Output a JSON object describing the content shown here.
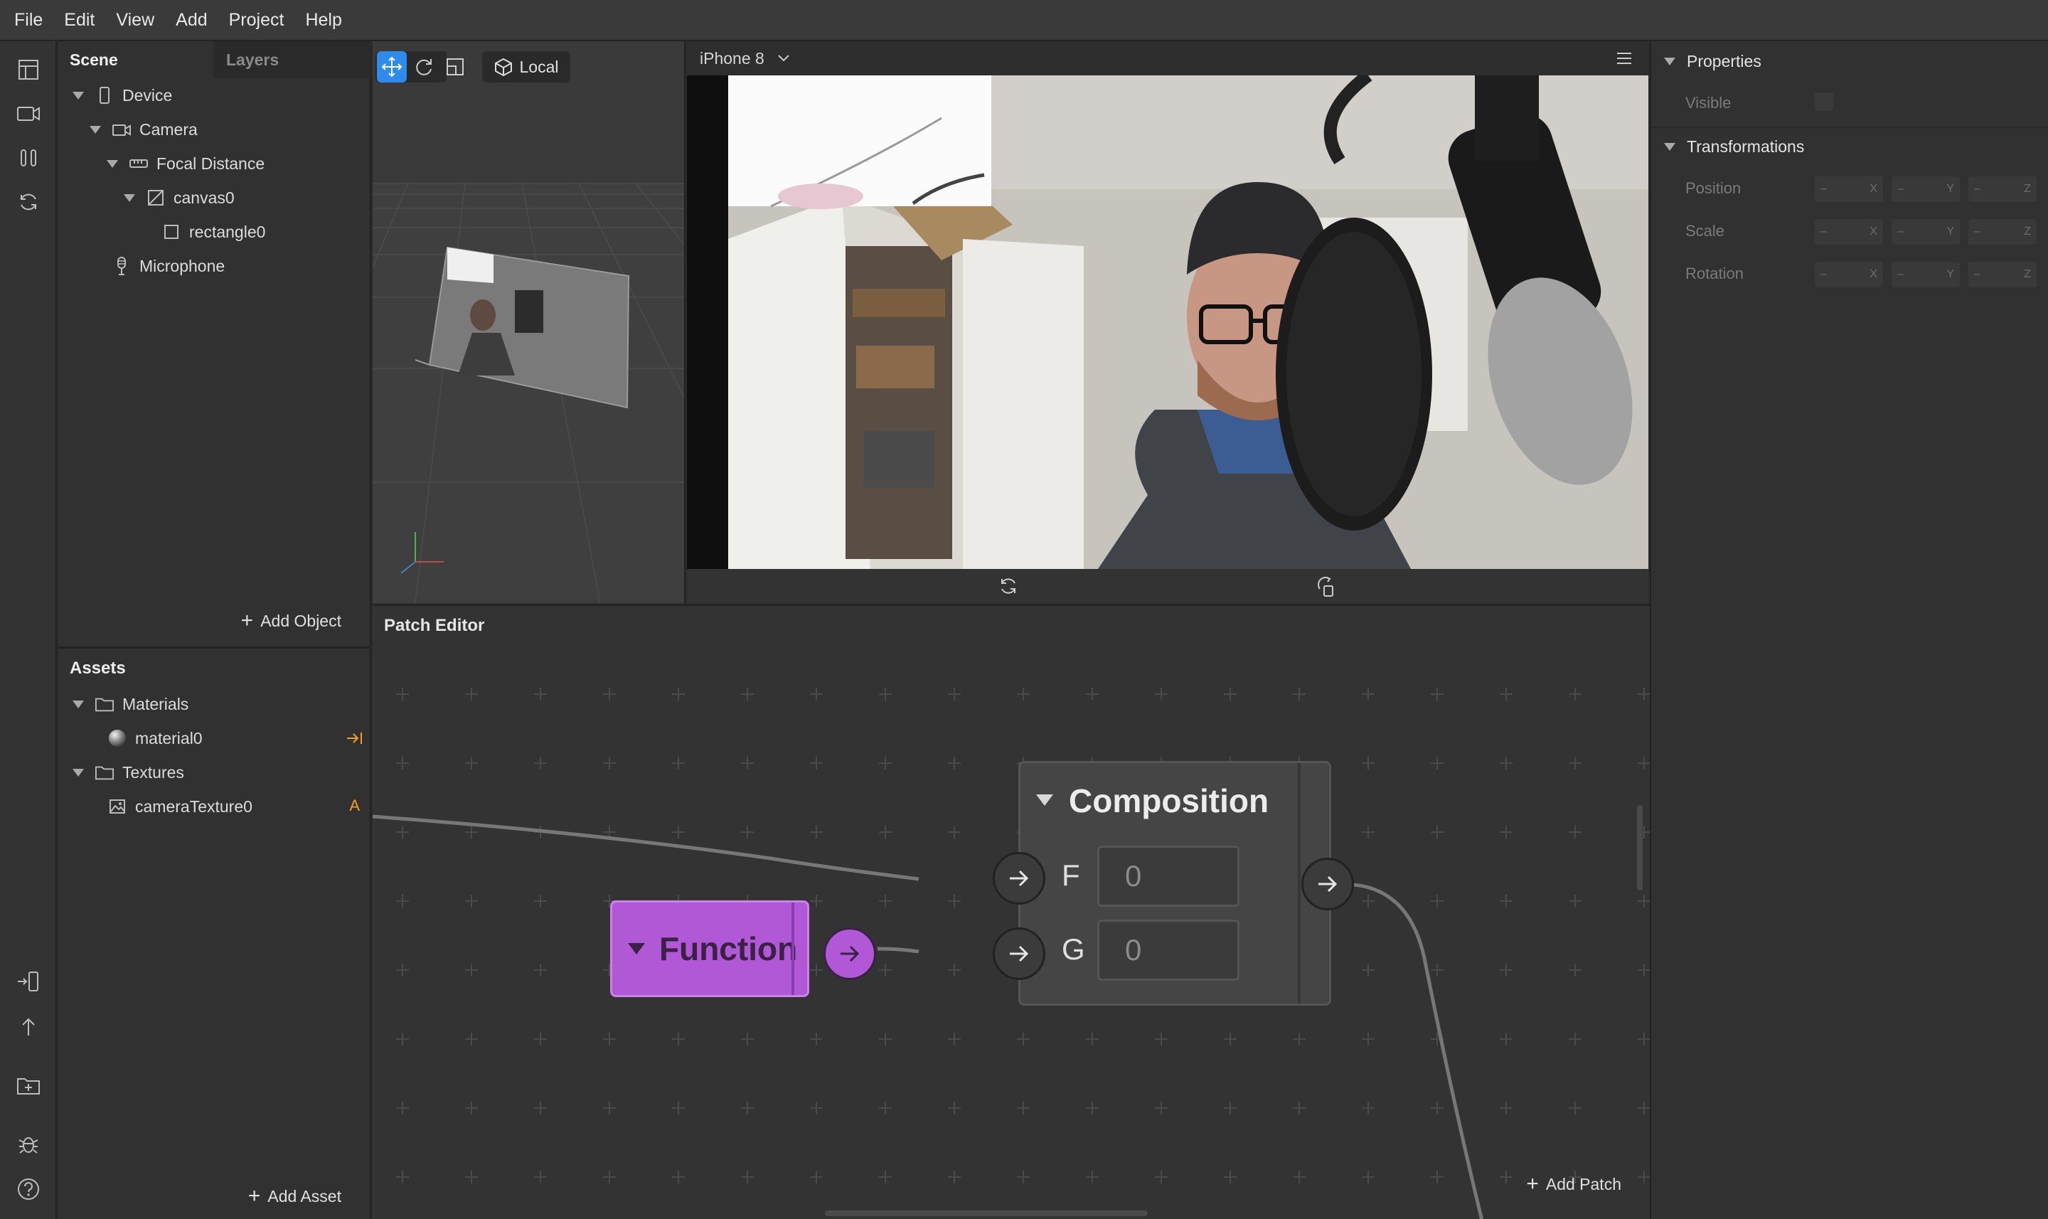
{
  "menu": [
    "File",
    "Edit",
    "View",
    "Add",
    "Project",
    "Help"
  ],
  "scene": {
    "tabs": [
      "Scene",
      "Layers"
    ],
    "tree": [
      {
        "label": "Device",
        "icon": "device-icon"
      },
      {
        "label": "Camera",
        "icon": "camera-icon"
      },
      {
        "label": "Focal Distance",
        "icon": "focal-distance-icon"
      },
      {
        "label": "canvas0",
        "icon": "canvas-icon"
      },
      {
        "label": "rectangle0",
        "icon": "rectangle-icon"
      },
      {
        "label": "Microphone",
        "icon": "microphone-icon"
      }
    ],
    "add_object": "Add Object"
  },
  "assets": {
    "title": "Assets",
    "materials_label": "Materials",
    "material0": "material0",
    "textures_label": "Textures",
    "texture0": "cameraTexture0",
    "texture_badge": "A"
  },
  "viewport": {
    "mode_label": "Local"
  },
  "simulator": {
    "device_label": "iPhone 8"
  },
  "properties": {
    "section_properties": "Properties",
    "visible_label": "Visible",
    "section_transformations": "Transformations",
    "position_label": "Position",
    "scale_label": "Scale",
    "rotation_label": "Rotation",
    "dash": "–",
    "axes": [
      "X",
      "Y",
      "Z"
    ]
  },
  "patch_editor": {
    "title": "Patch Editor",
    "function_label": "Function",
    "composition_label": "Composition",
    "input_f": "F",
    "input_g": "G",
    "f_value": "0",
    "g_value": "0",
    "add_patch": "Add Patch"
  },
  "colors": {
    "accent": "#2d8ceb",
    "function_purple": "#b158d6",
    "warning": "#f0a020"
  }
}
